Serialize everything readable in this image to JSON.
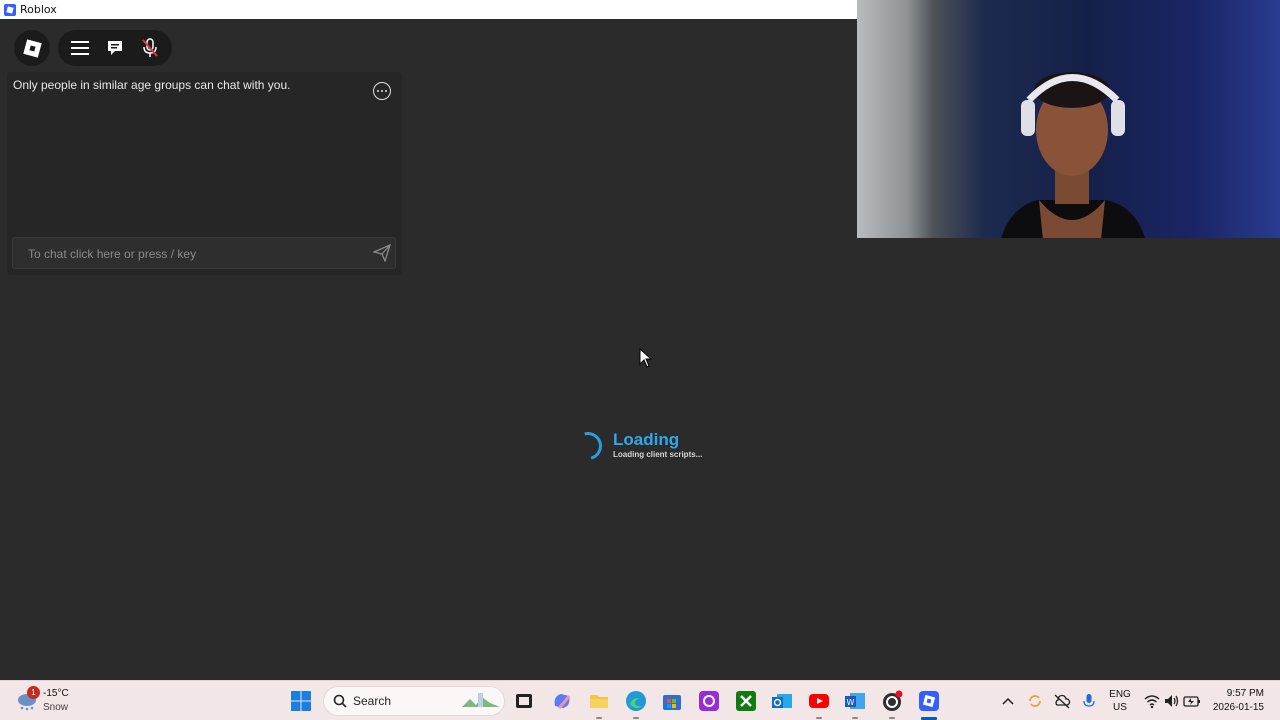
{
  "window": {
    "title": "Roblox"
  },
  "chat": {
    "notice": "Only people in similar age groups can chat with you.",
    "input_placeholder": "To chat click here or press / key"
  },
  "loading": {
    "title": "Loading",
    "status": "Loading client scripts..."
  },
  "icons": {
    "roblox_menu": "roblox-logo-icon",
    "menu": "hamburger-menu-icon",
    "chat": "chat-bubble-icon",
    "mic": "microphone-muted-icon",
    "more": "more-options-icon",
    "send": "send-icon"
  },
  "taskbar": {
    "weather": {
      "badge": "1",
      "temperature": "-15°C",
      "condition": "Snow"
    },
    "search_label": "Search",
    "apps": [
      "windows-start-icon",
      "search-icon",
      "task-view-icon",
      "copilot-icon",
      "file-explorer-icon",
      "edge-icon",
      "microsoft-store-icon",
      "app-icon",
      "xbox-icon",
      "outlook-icon",
      "youtube-icon",
      "word-icon",
      "obs-icon",
      "roblox-icon"
    ],
    "language": {
      "lang": "ENG",
      "region": "US"
    },
    "clock": {
      "time": "9:57 PM",
      "date": "2026-01-15"
    }
  },
  "colors": {
    "accent_loading": "#2fa9ec",
    "background": "#2b2b2b",
    "taskbar": "#f2e6e6"
  }
}
